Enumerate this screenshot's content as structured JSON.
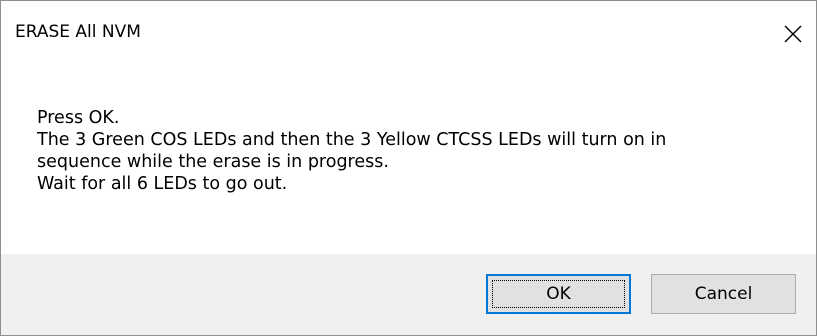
{
  "window": {
    "title": "ERASE All NVM",
    "close_icon": "close-icon"
  },
  "message": {
    "lines": [
      "Press OK.",
      "The 3 Green COS LEDs and then the 3 Yellow CTCSS LEDs will turn on in",
      "sequence while the erase is in progress.",
      "Wait for all 6 LEDs to go out."
    ]
  },
  "buttons": {
    "ok_label": "OK",
    "cancel_label": "Cancel"
  },
  "colors": {
    "footer_background": "#f0f0f0",
    "focus_border": "#0078d7",
    "button_face": "#e1e1e1"
  }
}
